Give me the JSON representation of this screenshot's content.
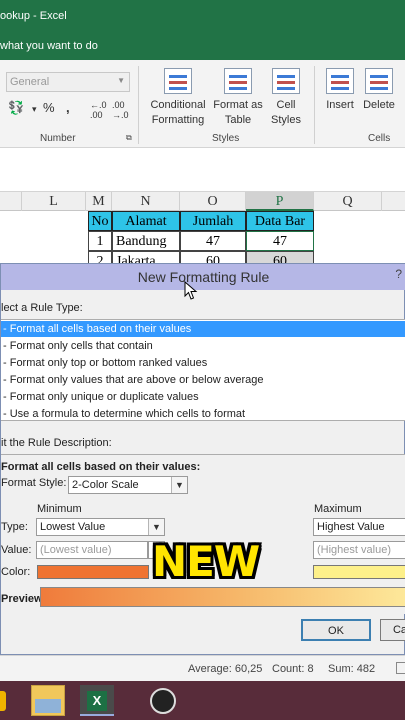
{
  "window": {
    "title": "ookup  -  Excel",
    "tell_me": "what you want to do"
  },
  "ribbon": {
    "number_format": "General",
    "number_group_label": "Number",
    "percent_symbol": "%",
    "comma_symbol": ",",
    "styles_group_label": "Styles",
    "cells_group_label": "Cells",
    "conditional_formatting": "Conditional Formatting",
    "format_as_table": "Format as Table",
    "cell_styles": "Cell Styles",
    "insert": "Insert",
    "delete": "Delete"
  },
  "sheet": {
    "columns": [
      "L",
      "M",
      "N",
      "O",
      "P",
      "Q"
    ],
    "selected_column": "P",
    "headers": [
      "No",
      "Alamat",
      "Jumlah",
      "Data Bar"
    ],
    "rows": [
      [
        "1",
        "Bandung",
        "47",
        "47"
      ],
      [
        "2",
        "Jakarta",
        "60",
        "60"
      ]
    ],
    "header_color": "#2ec4e8"
  },
  "dialog": {
    "title": "New Formatting Rule",
    "help": "?",
    "select_rule_type_label": "lect a Rule Type:",
    "rule_types": [
      "- Format all cells based on their values",
      "- Format only cells that contain",
      "- Format only top or bottom ranked values",
      "- Format only values that are above or below average",
      "- Format only unique or duplicate values",
      "- Use a formula to determine which cells to format"
    ],
    "edit_description_label": "it the Rule Description:",
    "description_heading": "Format all cells based on their values:",
    "format_style_label": "Format Style:",
    "format_style_value": "2-Color Scale",
    "minimum_label": "Minimum",
    "maximum_label": "Maximum",
    "type_label": "Type:",
    "value_label": "Value:",
    "color_label": "Color:",
    "min_type": "Lowest Value",
    "max_type": "Highest Value",
    "min_value_placeholder": "(Lowest value)",
    "max_value_placeholder": "(Highest value)",
    "min_color": "#ef7331",
    "max_color": "#fdf08a",
    "preview_label": "Preview:",
    "ok": "OK",
    "cancel": "Ca"
  },
  "sticker_text": "NEW",
  "status": {
    "average": "Average: 60,25",
    "count": "Count: 8",
    "sum": "Sum: 482"
  }
}
